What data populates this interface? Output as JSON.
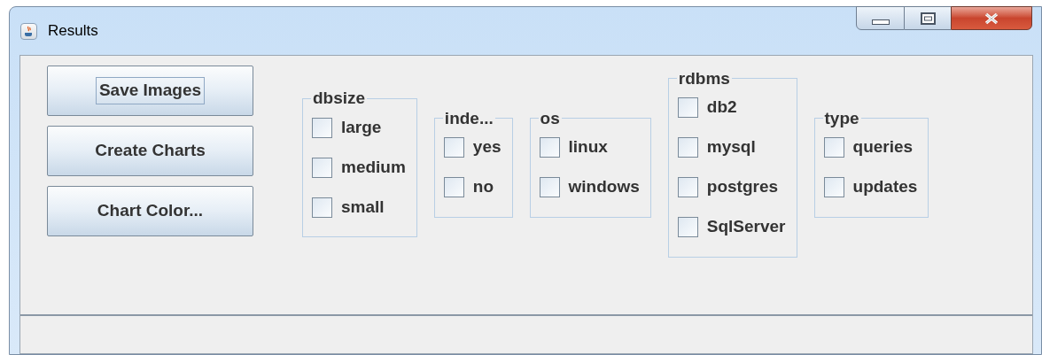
{
  "window": {
    "title": "Results"
  },
  "buttons": [
    {
      "label": "Save Images",
      "focused": true
    },
    {
      "label": "Create Charts",
      "focused": false
    },
    {
      "label": "Chart Color...",
      "focused": false
    }
  ],
  "groups": [
    {
      "title": "dbsize",
      "options": [
        {
          "label": "large",
          "checked": false
        },
        {
          "label": "medium",
          "checked": false
        },
        {
          "label": "small",
          "checked": false
        }
      ]
    },
    {
      "title": "inde...",
      "options": [
        {
          "label": "yes",
          "checked": false
        },
        {
          "label": "no",
          "checked": false
        }
      ]
    },
    {
      "title": "os",
      "options": [
        {
          "label": "linux",
          "checked": false
        },
        {
          "label": "windows",
          "checked": false
        }
      ]
    },
    {
      "title": "rdbms",
      "options": [
        {
          "label": "db2",
          "checked": false
        },
        {
          "label": "mysql",
          "checked": false
        },
        {
          "label": "postgres",
          "checked": false
        },
        {
          "label": "SqlServer",
          "checked": false
        }
      ]
    },
    {
      "title": "type",
      "options": [
        {
          "label": "queries",
          "checked": false
        },
        {
          "label": "updates",
          "checked": false
        }
      ]
    }
  ]
}
